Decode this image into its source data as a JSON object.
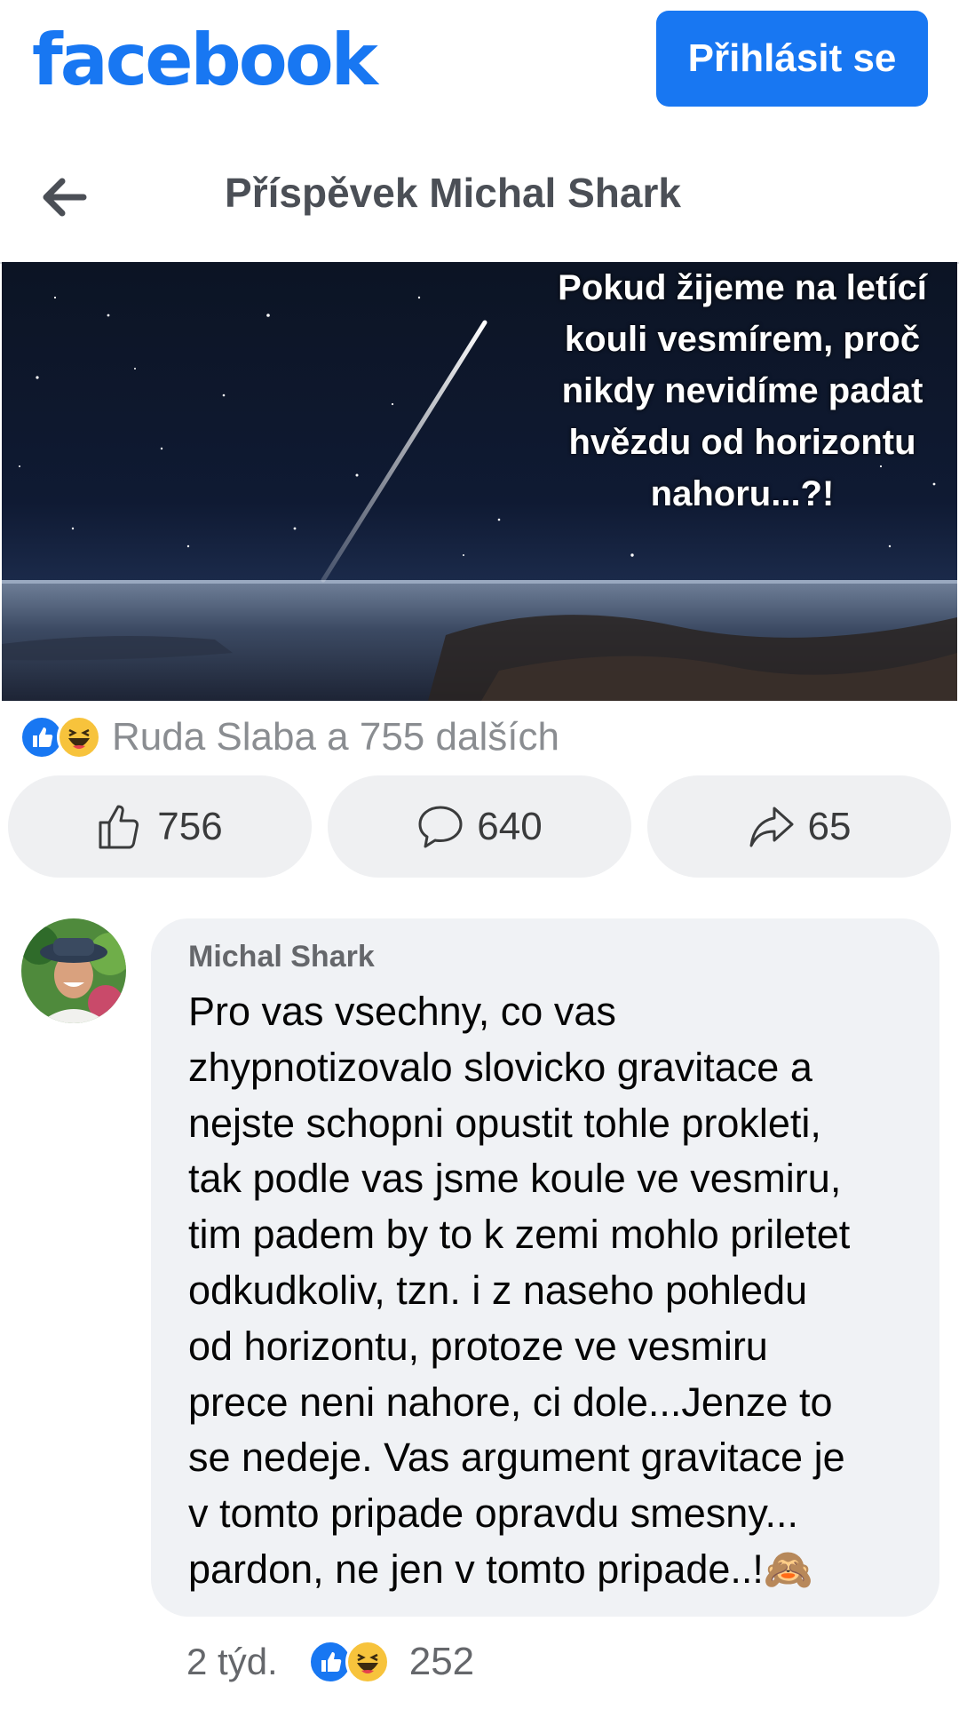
{
  "header": {
    "logo": "facebook",
    "login_label": "Přihlásit se"
  },
  "subheader": {
    "title": "Příspěvek Michal Shark"
  },
  "post": {
    "image_text": "Pokud žijeme na letící kouli vesmírem, proč nikdy nevidíme padat hvězdu od horizontu nahoru...?!",
    "reactions_summary": "Ruda Slaba a 755 dalších",
    "reaction_icons": [
      "like-icon",
      "haha-icon"
    ],
    "actions": {
      "likes": "756",
      "comments": "640",
      "shares": "65"
    }
  },
  "comment": {
    "author": "Michal Shark",
    "text": "Pro vas vsechny, co vas\nzhypnotizovalo slovicko gravitace a\nnejste schopni opustit tohle prokleti,\ntak podle vas jsme koule ve vesmiru,\ntim padem by to k zemi mohlo priletet\nodkudkoliv, tzn. i z naseho pohledu\nod horizontu, protoze ve vesmiru\nprece neni nahore, ci dole...Jenze to\nse nedeje. Vas argument gravitace je\nv tomto pripade opravdu smesny...\npardon, ne jen v tomto pripade..!🙈",
    "time": "2 týd.",
    "reaction_count": "252"
  },
  "colors": {
    "brand": "#1877f2",
    "bubble": "#f0f2f5",
    "action_bg": "#eff0f2",
    "muted_text": "#65676b"
  }
}
